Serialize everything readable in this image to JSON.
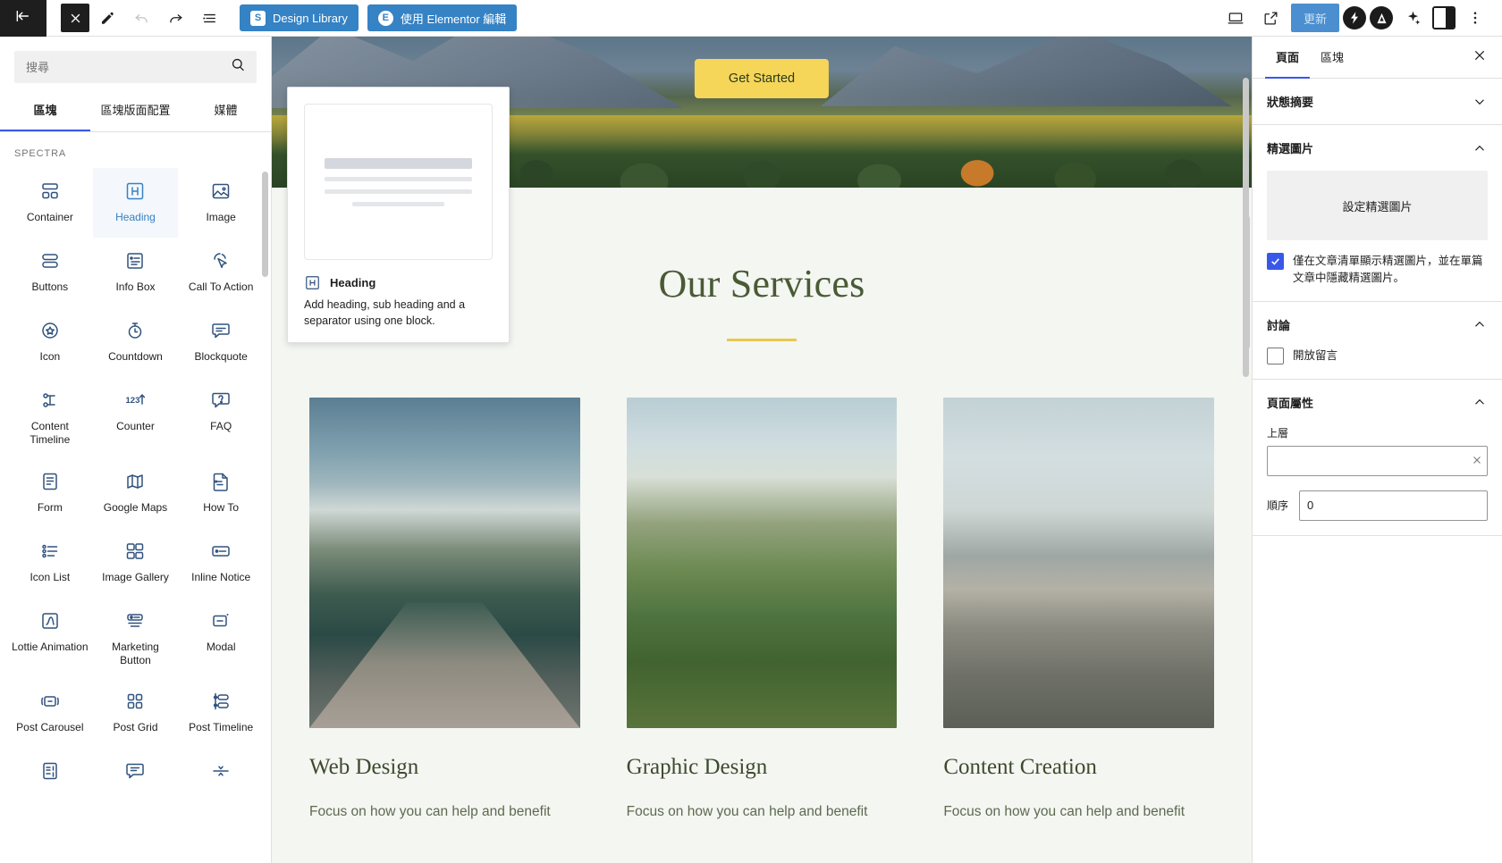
{
  "toolbar": {
    "back_label": "返回",
    "close_label": "關閉",
    "edit_label": "編輯",
    "undo_label": "復原",
    "redo_label": "重做",
    "list_view_label": "文件總覽",
    "design_library": "Design Library",
    "design_library_badge": "S",
    "elementor_label": "使用 Elementor 編輯",
    "elementor_badge": "E",
    "device_label": "檢視裝置",
    "preview_label": "預覽",
    "update_label": "更新",
    "spectra_badge": "S",
    "astra_badge": "A",
    "ai_label": "AI",
    "sidebar_toggle_label": "設定",
    "options_label": "選項",
    "accent_blue": "#3582c4",
    "update_bg": "#4b8fd0"
  },
  "inserter": {
    "search": {
      "placeholder": "搜尋",
      "value": "",
      "icon": "search-icon"
    },
    "tabs": [
      {
        "label": "區塊",
        "active": true
      },
      {
        "label": "區塊版面配置",
        "active": false
      },
      {
        "label": "媒體",
        "active": false
      }
    ],
    "category": "SPECTRA",
    "blocks": [
      {
        "label": "Container",
        "icon": "container-icon",
        "selected": false
      },
      {
        "label": "Heading",
        "icon": "heading-icon",
        "selected": true
      },
      {
        "label": "Image",
        "icon": "image-icon",
        "selected": false
      },
      {
        "label": "Buttons",
        "icon": "buttons-icon",
        "selected": false
      },
      {
        "label": "Info Box",
        "icon": "info-box-icon",
        "selected": false
      },
      {
        "label": "Call To Action",
        "icon": "call-to-action-icon",
        "selected": false
      },
      {
        "label": "Icon",
        "icon": "icon-icon",
        "selected": false
      },
      {
        "label": "Countdown",
        "icon": "countdown-icon",
        "selected": false
      },
      {
        "label": "Blockquote",
        "icon": "blockquote-icon",
        "selected": false
      },
      {
        "label": "Content Timeline",
        "icon": "content-timeline-icon",
        "selected": false
      },
      {
        "label": "Counter",
        "icon": "counter-icon",
        "selected": false
      },
      {
        "label": "FAQ",
        "icon": "faq-icon",
        "selected": false
      },
      {
        "label": "Form",
        "icon": "form-icon",
        "selected": false
      },
      {
        "label": "Google Maps",
        "icon": "google-maps-icon",
        "selected": false
      },
      {
        "label": "How To",
        "icon": "how-to-icon",
        "selected": false
      },
      {
        "label": "Icon List",
        "icon": "icon-list-icon",
        "selected": false
      },
      {
        "label": "Image Gallery",
        "icon": "image-gallery-icon",
        "selected": false
      },
      {
        "label": "Inline Notice",
        "icon": "inline-notice-icon",
        "selected": false
      },
      {
        "label": "Lottie Animation",
        "icon": "lottie-animation-icon",
        "selected": false
      },
      {
        "label": "Marketing Button",
        "icon": "marketing-button-icon",
        "selected": false
      },
      {
        "label": "Modal",
        "icon": "modal-icon",
        "selected": false
      },
      {
        "label": "Post Carousel",
        "icon": "post-carousel-icon",
        "selected": false
      },
      {
        "label": "Post Grid",
        "icon": "post-grid-icon",
        "selected": false
      },
      {
        "label": "Post Timeline",
        "icon": "post-timeline-icon",
        "selected": false
      },
      {
        "label": "",
        "icon": "price-list-icon",
        "selected": false
      },
      {
        "label": "",
        "icon": "review-icon",
        "selected": false
      },
      {
        "label": "",
        "icon": "separator-icon",
        "selected": false
      }
    ]
  },
  "preview_popover": {
    "icon": "heading-icon",
    "title": "Heading",
    "description": "Add heading, sub heading and a separator using one block."
  },
  "canvas": {
    "hero": {
      "button_label": "Get Started"
    },
    "services_title": "Our Services",
    "cards": [
      {
        "title": "Web Design",
        "text": "Focus on how you can help and benefit"
      },
      {
        "title": "Graphic Design",
        "text": "Focus on how you can help and benefit"
      },
      {
        "title": "Content Creation",
        "text": "Focus on how you can help and benefit"
      }
    ]
  },
  "settings": {
    "tabs": [
      {
        "label": "頁面",
        "active": true
      },
      {
        "label": "區塊",
        "active": false
      }
    ],
    "close_label": "關閉設定",
    "panels": {
      "summary": {
        "title": "狀態摘要",
        "expanded": false,
        "chevron": "chevron-down-icon"
      },
      "featured_image": {
        "title": "精選圖片",
        "expanded": true,
        "chevron": "chevron-up-icon",
        "set_button": "設定精選圖片",
        "checkbox_label": "僅在文章清單顯示精選圖片，並在單篇文章中隱藏精選圖片。",
        "checkbox_checked": true
      },
      "discussion": {
        "title": "討論",
        "expanded": true,
        "chevron": "chevron-up-icon",
        "checkbox_label": "開放留言",
        "checkbox_checked": false
      },
      "page_attributes": {
        "title": "頁面屬性",
        "expanded": true,
        "chevron": "chevron-up-icon",
        "parent_label": "上層",
        "parent_value": "",
        "order_label": "順序",
        "order_value": "0"
      }
    }
  }
}
